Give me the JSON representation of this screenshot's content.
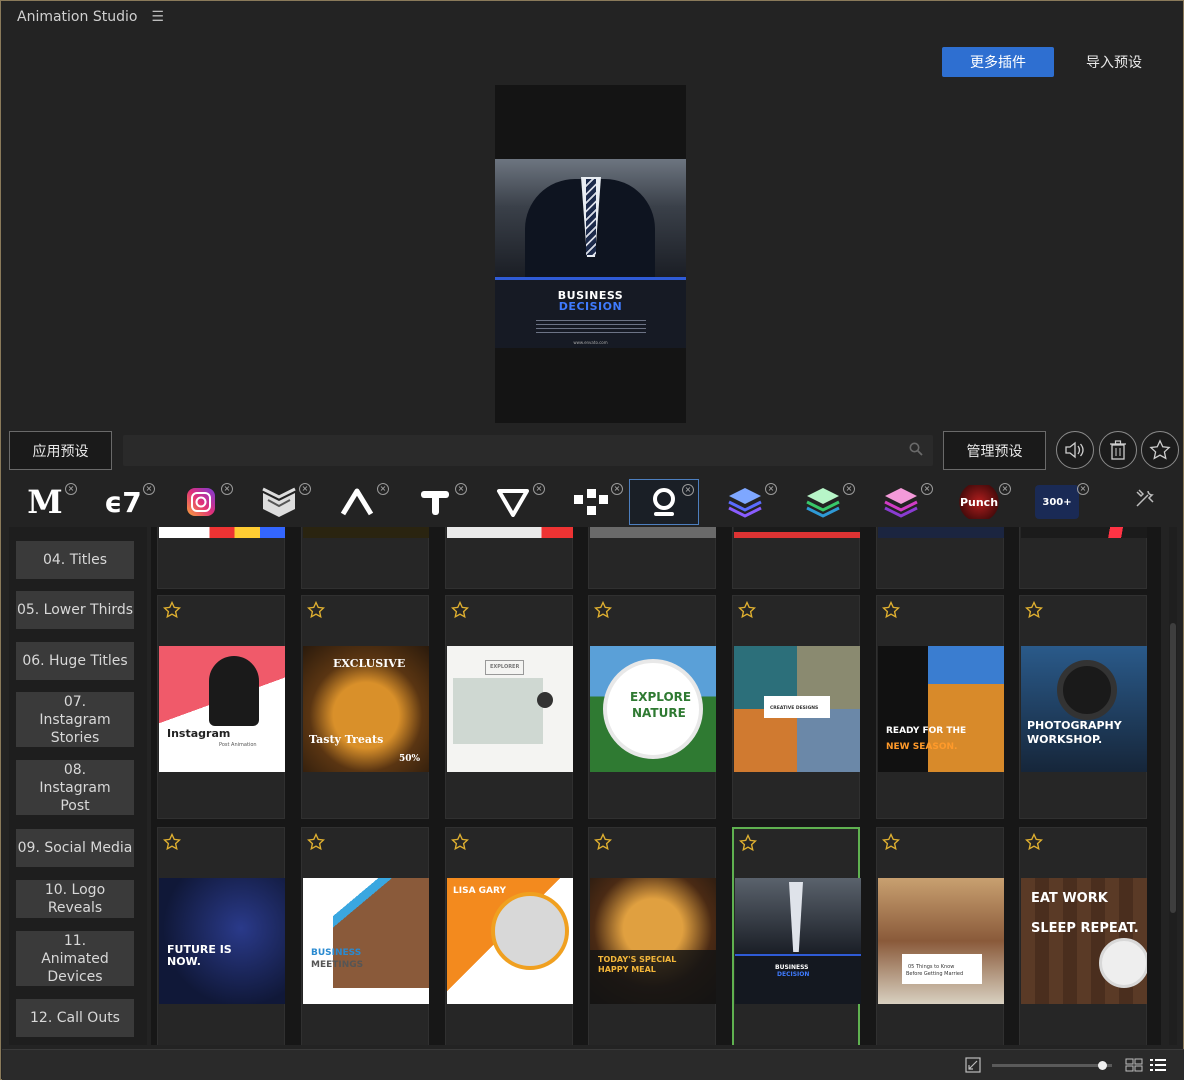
{
  "app": {
    "title": "Animation Studio"
  },
  "header": {
    "more_plugins": "更多插件",
    "import_presets": "导入预设"
  },
  "preview": {
    "headline1": "BUSINESS",
    "headline2": "DECISION",
    "url": "www.envato.com"
  },
  "toolbar": {
    "apply_preset": "应用预设",
    "search_placeholder": "",
    "manage_presets": "管理预设",
    "sound_icon": "speaker-icon",
    "trash_icon": "trash-icon",
    "favorite_icon": "star-icon"
  },
  "plugins": [
    {
      "name": "m-logo",
      "label": "M"
    },
    {
      "name": "e7-logo",
      "label": "E7"
    },
    {
      "name": "instagram-logo",
      "label": ""
    },
    {
      "name": "chevron-logo",
      "label": ""
    },
    {
      "name": "a-logo",
      "label": ""
    },
    {
      "name": "t-logo",
      "label": ""
    },
    {
      "name": "v-logo",
      "label": ""
    },
    {
      "name": "nodes-logo",
      "label": ""
    },
    {
      "name": "o-logo",
      "label": ""
    },
    {
      "name": "stack-blue-logo",
      "label": ""
    },
    {
      "name": "stack-green-logo",
      "label": ""
    },
    {
      "name": "stack-pink-logo",
      "label": ""
    },
    {
      "name": "punch-logo",
      "label": "Punch"
    },
    {
      "name": "transitions-logo",
      "label": "300+"
    }
  ],
  "categories": [
    {
      "label": "04. Titles"
    },
    {
      "label": "05. Lower Thirds"
    },
    {
      "label": "06. Huge Titles"
    },
    {
      "label": "07. Instagram Stories"
    },
    {
      "label": "08. Instagram Post"
    },
    {
      "label": "09. Social Media"
    },
    {
      "label": "10. Logo Reveals"
    },
    {
      "label": "11. Animated Devices"
    },
    {
      "label": "12. Call Outs"
    }
  ],
  "cards_row2": [
    {
      "title": "Instagram",
      "sub": "Post Animation"
    },
    {
      "title": "EXCLUSIVE",
      "sub": "Tasty Treats",
      "extra": "50%"
    },
    {
      "title": "EXPLORER",
      "sub": ""
    },
    {
      "title": "EXPLORE",
      "sub": "NATURE"
    },
    {
      "title": "CREATIVE DESIGNS",
      "sub": ""
    },
    {
      "title": "READY FOR THE",
      "sub": "NEW SEASON."
    },
    {
      "title": "PHOTOGRAPHY",
      "sub": "WORKSHOP."
    }
  ],
  "cards_row3": [
    {
      "title": "FUTURE IS",
      "sub": "NOW."
    },
    {
      "title": "BUSINESS",
      "sub": "MEETINGS"
    },
    {
      "title": "LISA GARY",
      "sub": ""
    },
    {
      "title": "TODAY'S SPECIAL",
      "sub": "HAPPY MEAL"
    },
    {
      "title": "BUSINESS",
      "sub": "DECISION"
    },
    {
      "title": "05 Things to Know",
      "sub": "Before Getting Married"
    },
    {
      "title": "EAT WORK",
      "sub": "SLEEP REPEAT."
    }
  ],
  "statusbar": {
    "zoom_value": 0.92
  },
  "colors": {
    "accent": "#2e6fd1",
    "selected": "#5fb150",
    "star": "#e0b030"
  }
}
